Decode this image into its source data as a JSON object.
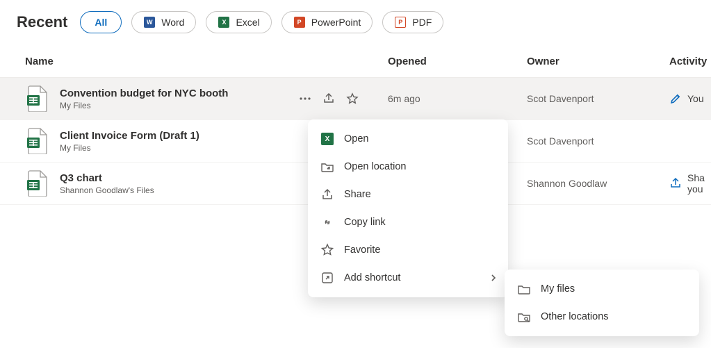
{
  "header": {
    "title": "Recent",
    "filters": [
      {
        "label": "All",
        "active": true,
        "icon": null
      },
      {
        "label": "Word",
        "active": false,
        "icon": "word"
      },
      {
        "label": "Excel",
        "active": false,
        "icon": "excel"
      },
      {
        "label": "PowerPoint",
        "active": false,
        "icon": "ppt"
      },
      {
        "label": "PDF",
        "active": false,
        "icon": "pdf"
      }
    ]
  },
  "table": {
    "columns": {
      "name": "Name",
      "opened": "Opened",
      "owner": "Owner",
      "activity": "Activity"
    },
    "rows": [
      {
        "name": "Convention budget for NYC booth",
        "location": "My Files",
        "opened": "6m ago",
        "owner": "Scot Davenport",
        "activity": "You",
        "hovered": true
      },
      {
        "name": "Client Invoice Form (Draft 1)",
        "location": "My Files",
        "opened": "",
        "owner": "Scot Davenport",
        "activity": "",
        "hovered": false
      },
      {
        "name": "Q3 chart",
        "location": "Shannon Goodlaw's Files",
        "opened": "",
        "owner": "Shannon Goodlaw",
        "activity": "Shannon Goodlaw shared with you",
        "activity_short": "Sha\nyou",
        "hovered": false
      }
    ]
  },
  "contextMenu": {
    "items": [
      {
        "label": "Open",
        "icon": "excel-app"
      },
      {
        "label": "Open location",
        "icon": "folder-open"
      },
      {
        "label": "Share",
        "icon": "share"
      },
      {
        "label": "Copy link",
        "icon": "link"
      },
      {
        "label": "Favorite",
        "icon": "star"
      },
      {
        "label": "Add shortcut",
        "icon": "shortcut",
        "hasSubmenu": true
      }
    ]
  },
  "submenu": {
    "items": [
      {
        "label": "My files",
        "icon": "folder"
      },
      {
        "label": "Other locations",
        "icon": "folder-search"
      }
    ]
  }
}
